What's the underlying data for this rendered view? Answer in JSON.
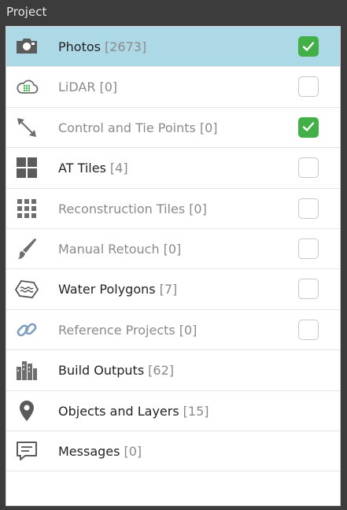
{
  "panel": {
    "title": "Project"
  },
  "items": [
    {
      "label": "Photos",
      "count": "[2673]",
      "icon": "camera-icon",
      "selected": true,
      "disabled": false,
      "has_checkbox": true,
      "checked": true
    },
    {
      "label": "LiDAR",
      "count": "[0]",
      "icon": "cloud-points-icon",
      "selected": false,
      "disabled": true,
      "has_checkbox": true,
      "checked": false
    },
    {
      "label": "Control and Tie Points",
      "count": "[0]",
      "icon": "double-arrow-icon",
      "selected": false,
      "disabled": true,
      "has_checkbox": true,
      "checked": true
    },
    {
      "label": "AT Tiles",
      "count": "[4]",
      "icon": "four-squares-icon",
      "selected": false,
      "disabled": false,
      "has_checkbox": true,
      "checked": false
    },
    {
      "label": "Reconstruction Tiles",
      "count": "[0]",
      "icon": "dot-grid-icon",
      "selected": false,
      "disabled": true,
      "has_checkbox": true,
      "checked": false
    },
    {
      "label": "Manual Retouch",
      "count": "[0]",
      "icon": "brush-icon",
      "selected": false,
      "disabled": true,
      "has_checkbox": true,
      "checked": false
    },
    {
      "label": "Water Polygons",
      "count": "[7]",
      "icon": "water-polygon-icon",
      "selected": false,
      "disabled": false,
      "has_checkbox": true,
      "checked": false
    },
    {
      "label": "Reference Projects",
      "count": "[0]",
      "icon": "link-icon",
      "selected": false,
      "disabled": true,
      "has_checkbox": true,
      "checked": false
    },
    {
      "label": "Build Outputs",
      "count": "[62]",
      "icon": "buildings-icon",
      "selected": false,
      "disabled": false,
      "has_checkbox": false,
      "checked": false
    },
    {
      "label": "Objects and Layers",
      "count": "[15]",
      "icon": "map-pin-icon",
      "selected": false,
      "disabled": false,
      "has_checkbox": false,
      "checked": false
    },
    {
      "label": "Messages",
      "count": "[0]",
      "icon": "message-bubble-icon",
      "selected": false,
      "disabled": false,
      "has_checkbox": false,
      "checked": false
    }
  ],
  "colors": {
    "selected_row": "#add8e6",
    "checkbox_on": "#43b047",
    "icon_gray": "#6e6e6e",
    "disabled_text": "#8a8a8a"
  }
}
